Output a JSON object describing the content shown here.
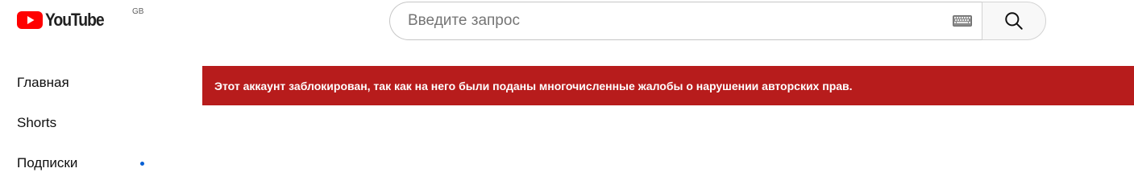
{
  "header": {
    "logo_text": "YouTube",
    "country_code": "GB",
    "logo_icon": "youtube-play-icon",
    "logo_color": "#ff0000"
  },
  "search": {
    "placeholder": "Введите запрос",
    "value": "",
    "keyboard_icon": "keyboard-icon",
    "search_icon": "search-icon"
  },
  "sidebar": {
    "items": [
      {
        "label": "Главная",
        "has_dot": false
      },
      {
        "label": "Shorts",
        "has_dot": false
      },
      {
        "label": "Подписки",
        "has_dot": true
      }
    ],
    "dot_color": "#065fd4"
  },
  "banner": {
    "message": "Этот аккаунт заблокирован, так как на него были поданы многочисленные жалобы о нарушении авторских прав.",
    "background_color": "#b71c1c"
  }
}
